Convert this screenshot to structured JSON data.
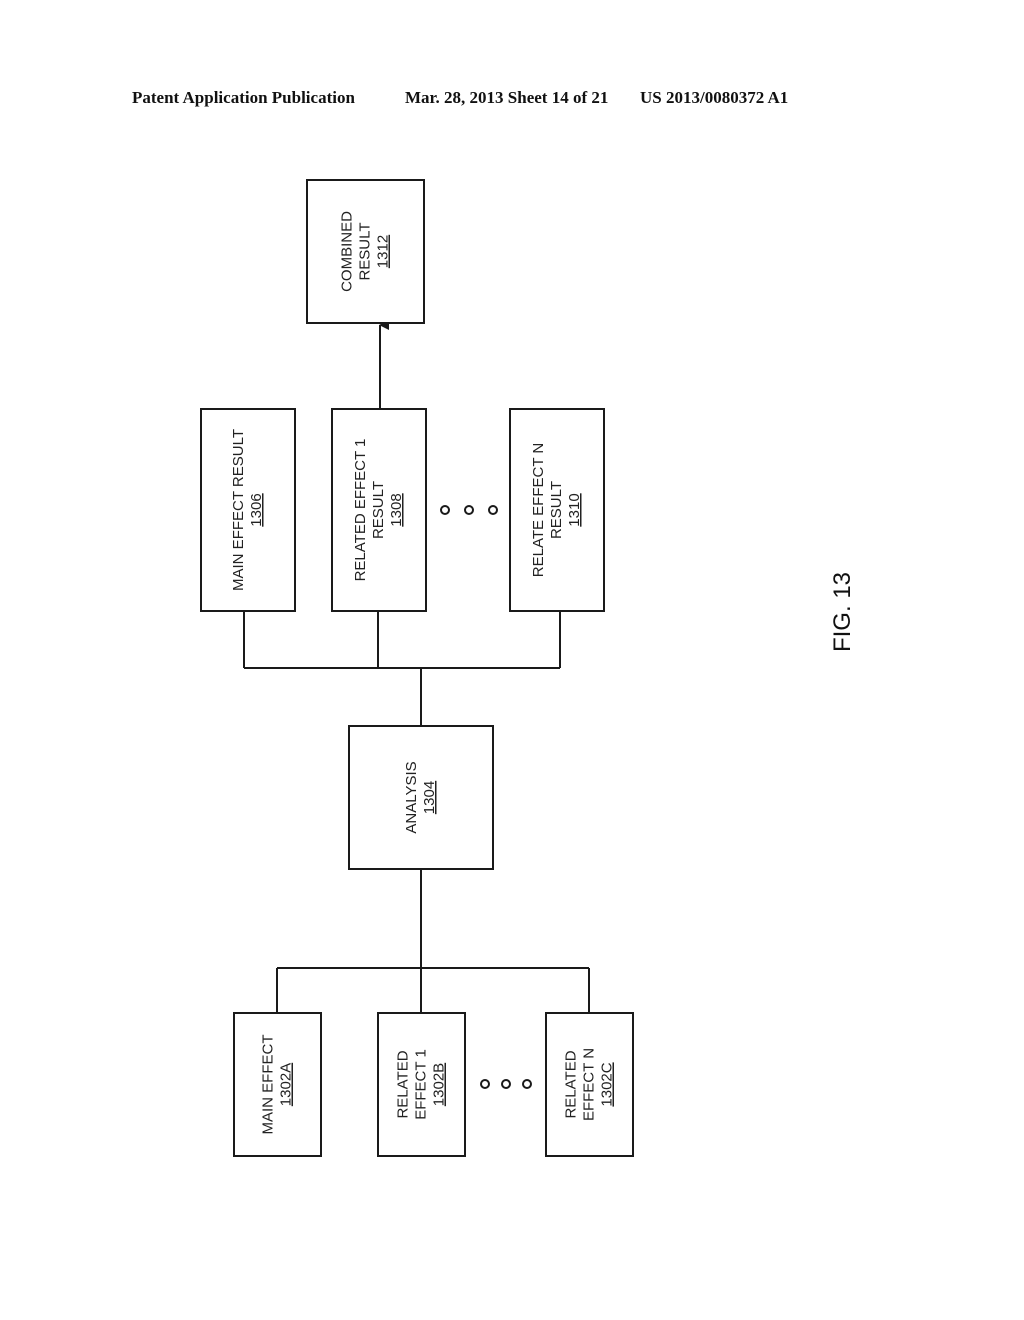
{
  "header": {
    "left": "Patent Application Publication",
    "center": "Mar. 28, 2013  Sheet 14 of 21",
    "right": "US 2013/0080372 A1"
  },
  "figure_label": "FIG. 13",
  "blocks": {
    "combined_result": {
      "lines": [
        "COMBINED",
        "RESULT"
      ],
      "ref": "1312"
    },
    "main_effect_result": {
      "lines": [
        "MAIN EFFECT RESULT"
      ],
      "ref": "1306"
    },
    "related_effect_1_result": {
      "lines": [
        "RELATED EFFECT 1",
        "RESULT"
      ],
      "ref": "1308"
    },
    "relate_effect_n_result": {
      "lines": [
        "RELATE EFFECT N",
        "RESULT"
      ],
      "ref": "1310"
    },
    "analysis": {
      "lines": [
        "ANALYSIS"
      ],
      "ref": "1304"
    },
    "main_effect": {
      "lines": [
        "MAIN EFFECT"
      ],
      "ref": "1302A"
    },
    "related_effect_1": {
      "lines": [
        "RELATED",
        "EFFECT 1"
      ],
      "ref": "1302B"
    },
    "related_effect_n": {
      "lines": [
        "RELATED",
        "EFFECT N"
      ],
      "ref": "1302C"
    }
  },
  "connections": [
    {
      "from": "main_effect",
      "to": "analysis"
    },
    {
      "from": "related_effect_1",
      "to": "analysis"
    },
    {
      "from": "related_effect_n",
      "to": "analysis"
    },
    {
      "from": "analysis",
      "to": "main_effect_result"
    },
    {
      "from": "analysis",
      "to": "related_effect_1_result"
    },
    {
      "from": "analysis",
      "to": "relate_effect_n_result"
    },
    {
      "from": "related_effect_1_result",
      "to": "combined_result",
      "arrow": true
    }
  ],
  "ellipsis_groups": [
    "results",
    "effects"
  ]
}
